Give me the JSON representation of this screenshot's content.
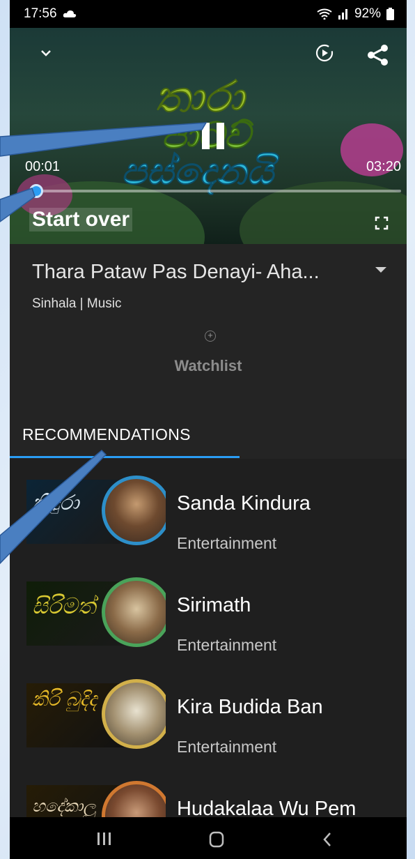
{
  "status_bar": {
    "time": "17:56",
    "battery": "92%"
  },
  "player": {
    "current_time": "00:01",
    "total_time": "03:20",
    "progress": 0.005,
    "start_over_label": "Start over",
    "icons": {
      "collapse": "chevron-down-icon",
      "autoplay": "autoplay-icon",
      "share": "share-icon",
      "pause": "pause-icon",
      "fullscreen": "fullscreen-icon"
    }
  },
  "video": {
    "title": "Thara Pataw Pas Denayi- Aha...",
    "meta": "Sinhala | Music",
    "watchlist_label": "Watchlist"
  },
  "recommendations": {
    "tab_label": "RECOMMENDATIONS",
    "items": [
      {
        "title": "Sanda Kindura",
        "category": "Entertainment"
      },
      {
        "title": "Sirimath",
        "category": "Entertainment"
      },
      {
        "title": "Kira Budida Ban",
        "category": "Entertainment"
      },
      {
        "title": "Hudakalaa Wu Pem",
        "category": ""
      }
    ]
  },
  "colors": {
    "accent": "#2a9df4",
    "annotation": "#4a7fc1"
  }
}
